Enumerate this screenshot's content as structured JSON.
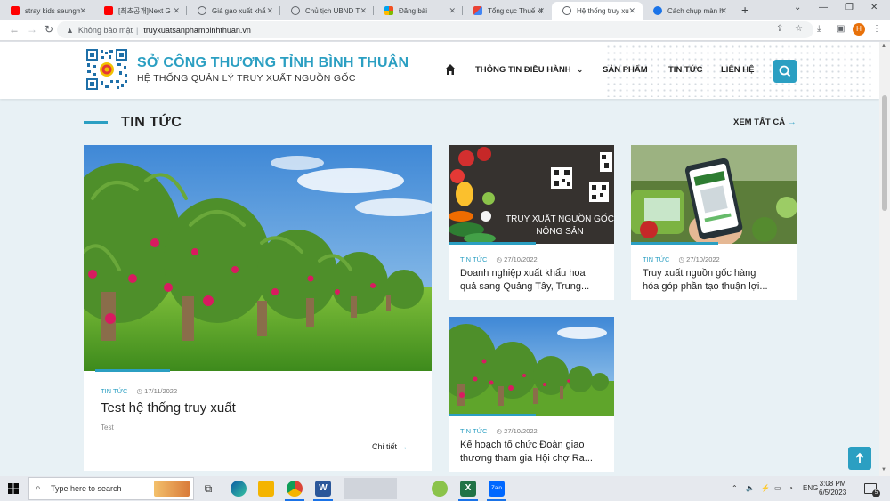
{
  "browser": {
    "tabs": [
      {
        "title": "stray kids seungm",
        "favicon": "youtube-icon",
        "color": "#ff0000"
      },
      {
        "title": "[최초공개]Next G",
        "favicon": "youtube-icon",
        "color": "#ff0000"
      },
      {
        "title": "Giá gạo xuất khẩ",
        "favicon": "globe-icon",
        "color": "#5f6368"
      },
      {
        "title": "Chủ tịch UBND T",
        "favicon": "globe-icon",
        "color": "#5f6368"
      },
      {
        "title": "Đăng bài",
        "favicon": "windows-grid-icon",
        "color": "#4caf50"
      },
      {
        "title": "Tổng cục Thuế kh",
        "favicon": "gmail-icon",
        "color": "#ea4335"
      },
      {
        "title": "Hệ thống truy xu",
        "favicon": "globe-icon",
        "color": "#5f6368",
        "active": true
      },
      {
        "title": "Cách chụp màn h",
        "favicon": "edge-icon",
        "color": "#1a73e8"
      }
    ],
    "security_label": "Không bảo mật",
    "url": "truyxuatsanphambinhthuan.vn",
    "profile_initial": "H"
  },
  "site": {
    "title": "SỞ CÔNG THƯƠNG TỈNH BÌNH THUẬN",
    "subtitle": "HỆ THỐNG QUẢN LÝ TRUY XUẤT NGUỒN GỐC",
    "nav": [
      "THÔNG TIN ĐIỀU HÀNH",
      "SẢN PHẨM",
      "TIN TỨC",
      "LIÊN HỆ"
    ],
    "accent_color": "#2b9fc2"
  },
  "news": {
    "section_title": "TIN TỨC",
    "see_all": "XEM TẤT CẢ",
    "featured": {
      "category": "TIN TỨC",
      "date": "17/11/2022",
      "title": "Test hệ thống truy xuất",
      "description": "Test",
      "more": "Chi tiết"
    },
    "cards": [
      {
        "category": "TIN TỨC",
        "date": "27/10/2022",
        "title_line1": "Doanh nghiệp xuất khẩu hoa",
        "title_line2": "quả sang Quảng Tây, Trung...",
        "image_text_1": "TRUY XUẤT NGUỒN GỐC",
        "image_text_2": "NÔNG SẢN"
      },
      {
        "category": "TIN TỨC",
        "date": "27/10/2022",
        "title_line1": "Truy xuất nguồn gốc hàng",
        "title_line2": "hóa góp phần tạo thuận lợi..."
      },
      {
        "category": "TIN TỨC",
        "date": "27/10/2022",
        "title_line1": "Kế hoạch tổ chức Đoàn giao",
        "title_line2": "thương tham gia Hội chợ Ra..."
      }
    ]
  },
  "taskbar": {
    "search_placeholder": "Type here to search",
    "language": "ENG",
    "time": "3:08 PM",
    "date": "6/5/2023",
    "notification_count": "5"
  }
}
